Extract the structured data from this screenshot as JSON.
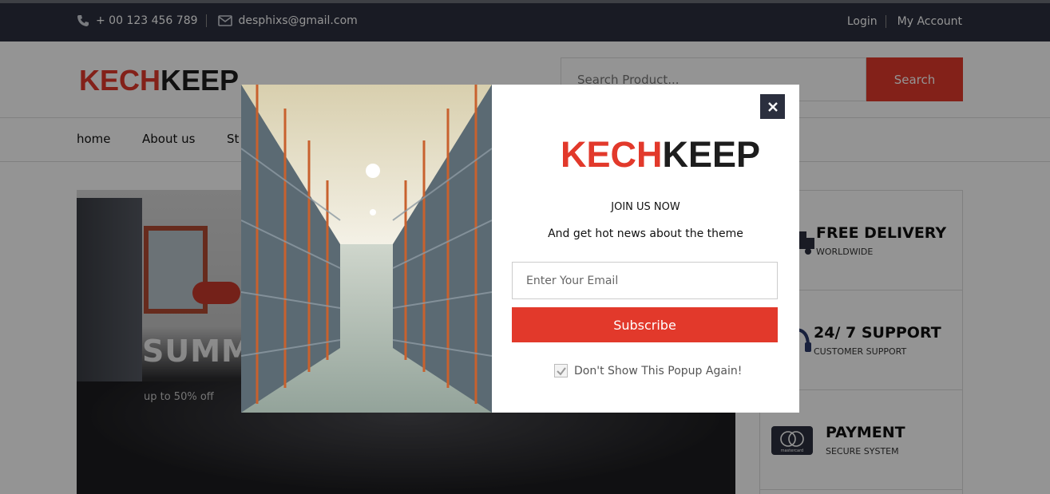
{
  "topbar": {
    "phone": "+ 00 123 456 789",
    "email": "desphixs@gmail.com",
    "login": "Login",
    "account": "My Account"
  },
  "header": {
    "logo_red": "KECH",
    "logo_black": "KEEP",
    "search_placeholder": "Search Product...",
    "search_button": "Search"
  },
  "nav": {
    "items": [
      {
        "label": "home"
      },
      {
        "label": "About us"
      },
      {
        "label": "St"
      }
    ]
  },
  "banner": {
    "title": "SUMM",
    "subtitle": "up to 50% off"
  },
  "services": [
    {
      "name": "FREE DELIVERY",
      "desc": "WORLDWIDE",
      "icon": "truck-icon"
    },
    {
      "name": "24/ 7 SUPPORT",
      "desc": "CUSTOMER SUPPORT",
      "icon": "headset-icon"
    },
    {
      "name": "PAYMENT",
      "desc": "SECURE SYSTEM",
      "icon": "mastercard-icon",
      "card_label": "mastercard"
    }
  ],
  "popup": {
    "logo_red": "KECH",
    "logo_black": "KEEP",
    "heading": "JOIN US NOW",
    "tagline": "And get hot news about the theme",
    "email_placeholder": "Enter Your Email",
    "subscribe": "Subscribe",
    "dont_show": "Don't Show This Popup Again!",
    "dont_show_checked": true,
    "close": "×"
  },
  "colors": {
    "brand_red": "#e2392b",
    "dark": "#2b2f3e"
  }
}
